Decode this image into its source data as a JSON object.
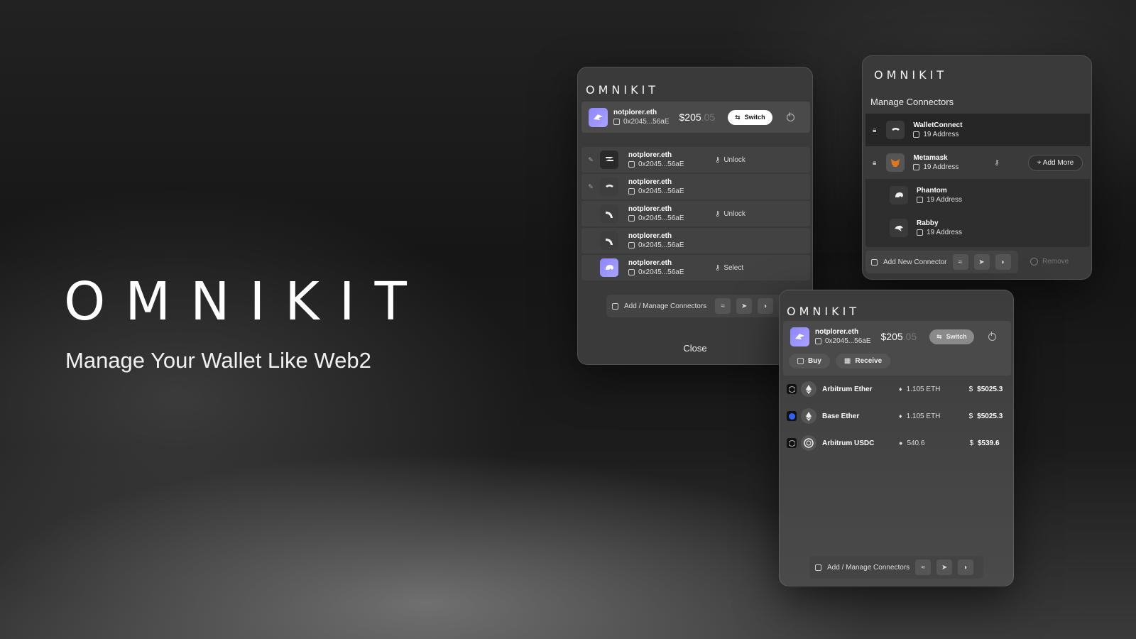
{
  "hero": {
    "logo": "OMNIKIT",
    "tagline": "Manage Your Wallet Like Web2"
  },
  "colors": {
    "accent": "#9a93ff",
    "panel_bg": "#3a3a3a",
    "row_bg": "#424242"
  },
  "wallet_panel": {
    "logo": "OMNIKIT",
    "account": {
      "name": "notplorer.eth",
      "address": "0x2045...56aE",
      "balance_main": "$205",
      "balance_dim": ".05",
      "switch_label": "Switch"
    },
    "rows": [
      {
        "icon": "zerion-icon",
        "name": "notplorer.eth",
        "address": "0x2045...56aE",
        "action": "Unlock",
        "pinned": true
      },
      {
        "icon": "walletconnect-icon",
        "name": "notplorer.eth",
        "address": "0x2045...56aE",
        "action": "",
        "pinned": true
      },
      {
        "icon": "rainbow-icon",
        "name": "notplorer.eth",
        "address": "0x2045...56aE",
        "action": "Unlock",
        "pinned": false
      },
      {
        "icon": "rainbow-icon",
        "name": "notplorer.eth",
        "address": "0x2045...56aE",
        "action": "",
        "pinned": false
      },
      {
        "icon": "phantom-icon",
        "name": "notplorer.eth",
        "address": "0x2045...56aE",
        "action": "Select",
        "pinned": false
      }
    ],
    "manage_label": "Add / Manage Connectors",
    "close_label": "Close"
  },
  "connectors_panel": {
    "logo": "OMNIKIT",
    "title": "Manage Connectors",
    "connectors": [
      {
        "icon": "walletconnect-icon",
        "name": "WalletConnect",
        "count": "19 Address"
      },
      {
        "icon": "metamask-icon",
        "name": "Metamask",
        "count": "19 Address"
      },
      {
        "icon": "phantom-icon",
        "name": "Phantom",
        "count": "19 Address"
      },
      {
        "icon": "rabby-icon",
        "name": "Rabby",
        "count": "19 Address"
      }
    ],
    "add_more_label": "+ Add More",
    "add_new_label": "Add New Connector",
    "remove_label": "Remove"
  },
  "assets_panel": {
    "logo": "OMNIKIT",
    "account": {
      "name": "notplorer.eth",
      "address": "0x2045...56aE",
      "balance_main": "$205",
      "balance_dim": ".05",
      "switch_label": "Switch"
    },
    "buy_label": "Buy",
    "receive_label": "Receive",
    "tokens": [
      {
        "name": "Arbitrum Ether",
        "amount": "1.105 ETH",
        "value": "$5025.3",
        "chain": "arbitrum"
      },
      {
        "name": "Base Ether",
        "amount": "1.105 ETH",
        "value": "$5025.3",
        "chain": "base"
      },
      {
        "name": "Arbitrum USDC",
        "amount": "540.6",
        "value": "$539.6",
        "chain": "arbitrum"
      }
    ],
    "manage_label": "Add / Manage Connectors"
  }
}
